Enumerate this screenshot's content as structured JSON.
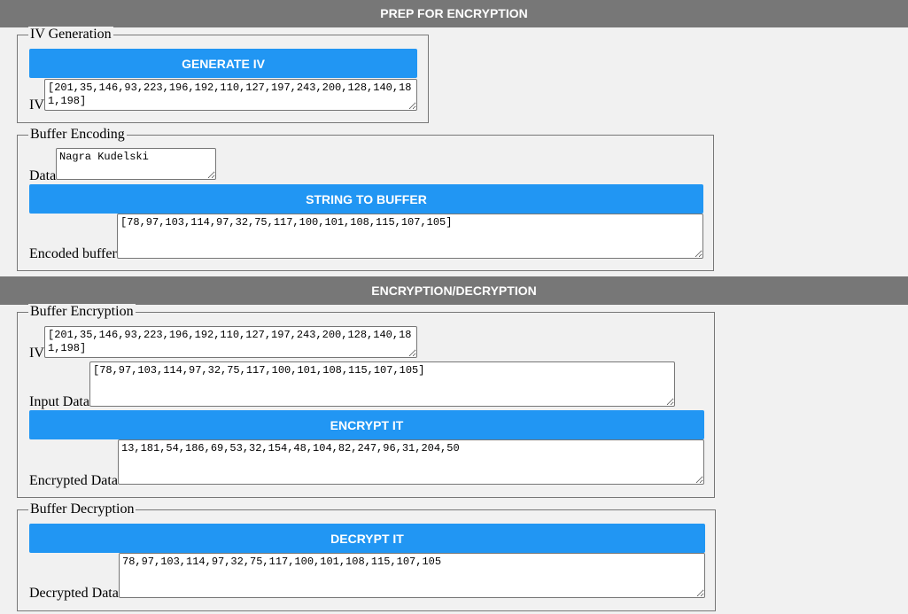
{
  "sections": {
    "prep": "PREP FOR ENCRYPTION",
    "encdec": "ENCRYPTION/DECRYPTION"
  },
  "iv_generation": {
    "legend": "IV Generation",
    "button": "GENERATE IV",
    "iv_label": "IV",
    "iv_value": "[201,35,146,93,223,196,192,110,127,197,243,200,128,140,181,198]"
  },
  "buffer_encoding": {
    "legend": "Buffer Encoding",
    "data_label": "Data",
    "data_value": "Nagra Kudelski",
    "button": "STRING TO BUFFER",
    "encoded_label": "Encoded buffer",
    "encoded_value": "[78,97,103,114,97,32,75,117,100,101,108,115,107,105]"
  },
  "buffer_encryption": {
    "legend": "Buffer Encryption",
    "iv_label": "IV",
    "iv_value": "[201,35,146,93,223,196,192,110,127,197,243,200,128,140,181,198]",
    "input_label": "Input Data",
    "input_value": "[78,97,103,114,97,32,75,117,100,101,108,115,107,105]",
    "button": "ENCRYPT IT",
    "encrypted_label": "Encrypted Data",
    "encrypted_value": "13,181,54,186,69,53,32,154,48,104,82,247,96,31,204,50"
  },
  "buffer_decryption": {
    "legend": "Buffer Decryption",
    "button": "DECRYPT IT",
    "decrypted_label": "Decrypted Data",
    "decrypted_value": "78,97,103,114,97,32,75,117,100,101,108,115,107,105"
  },
  "colors": {
    "header_bar": "#777777",
    "button": "#2196f3",
    "background": "#f1f1f1"
  }
}
